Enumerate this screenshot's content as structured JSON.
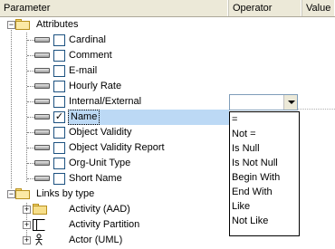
{
  "columns": {
    "parameter": "Parameter",
    "operator": "Operator",
    "value": "Value"
  },
  "tree": {
    "attributes_label": "Attributes",
    "attributes": [
      {
        "label": "Cardinal",
        "checked": false
      },
      {
        "label": "Comment",
        "checked": false
      },
      {
        "label": "E-mail",
        "checked": false
      },
      {
        "label": "Hourly Rate",
        "checked": false
      },
      {
        "label": "Internal/External",
        "checked": false
      },
      {
        "label": "Name",
        "checked": true
      },
      {
        "label": "Object Validity",
        "checked": false
      },
      {
        "label": "Object Validity Report",
        "checked": false
      },
      {
        "label": "Org-Unit Type",
        "checked": false
      },
      {
        "label": "Short Name",
        "checked": false
      }
    ],
    "links_label": "Links by type",
    "links": [
      {
        "label": "Activity (AAD)",
        "icon": "folder-icon"
      },
      {
        "label": "Activity Partition",
        "icon": "partition-icon"
      },
      {
        "label": "Actor (UML)",
        "icon": "actor-icon"
      }
    ],
    "checkmark": "✓"
  },
  "operator_combo": {
    "value": ""
  },
  "operator_options": [
    "=",
    "Not =",
    "Is Null",
    "Is Not Null",
    "Begin With",
    "End With",
    "Like",
    "Not Like"
  ]
}
